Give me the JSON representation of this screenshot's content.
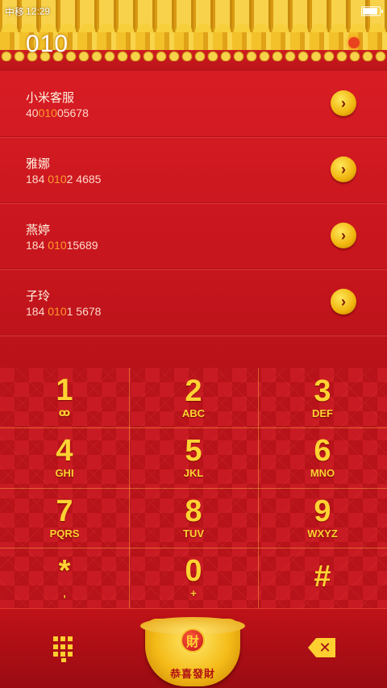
{
  "status": {
    "carrier": "中移",
    "time": "12:29"
  },
  "dialer": {
    "entered_number": "010"
  },
  "contacts": [
    {
      "name": "小米客服",
      "num_pre": "40",
      "num_hl": "010",
      "num_post": "05678"
    },
    {
      "name": "雅娜",
      "num_pre": "184 ",
      "num_hl": "010",
      "num_post": "2 4685"
    },
    {
      "name": "燕婷",
      "num_pre": "184 ",
      "num_hl": "010",
      "num_post": "15689"
    },
    {
      "name": "子玲",
      "num_pre": "184 ",
      "num_hl": "010",
      "num_post": "1 5678"
    }
  ],
  "keys": [
    {
      "digit": "1",
      "letters": "ꝏ"
    },
    {
      "digit": "2",
      "letters": "ABC"
    },
    {
      "digit": "3",
      "letters": "DEF"
    },
    {
      "digit": "4",
      "letters": "GHI"
    },
    {
      "digit": "5",
      "letters": "JKL"
    },
    {
      "digit": "6",
      "letters": "MNO"
    },
    {
      "digit": "7",
      "letters": "PQRS"
    },
    {
      "digit": "8",
      "letters": "TUV"
    },
    {
      "digit": "9",
      "letters": "WXYZ"
    },
    {
      "digit": "*",
      "letters": ","
    },
    {
      "digit": "0",
      "letters": "+"
    },
    {
      "digit": "#",
      "letters": ""
    }
  ],
  "bottom": {
    "call_label": "恭喜發財",
    "coin_char": "財"
  },
  "icons": {
    "arrow": "chevron-right-icon",
    "dialpad": "dialpad-icon",
    "delete": "backspace-icon",
    "battery": "battery-icon"
  },
  "colors": {
    "accent": "#ffd233",
    "highlight": "#ff9a2a",
    "background": "#c5151d"
  }
}
